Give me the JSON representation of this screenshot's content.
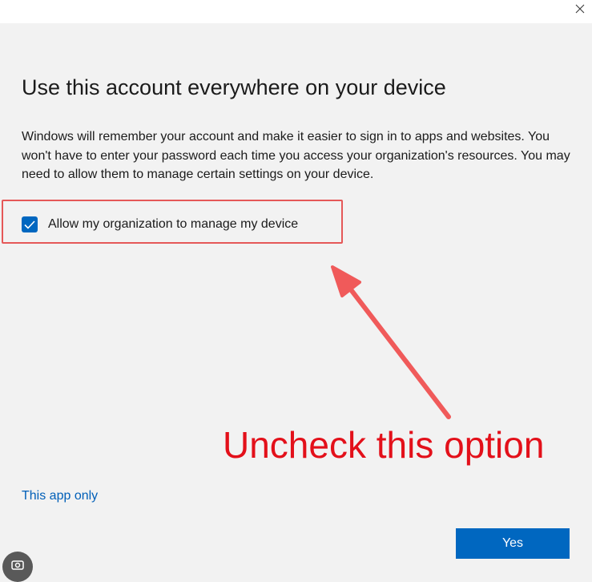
{
  "window": {
    "close_icon": "close-icon"
  },
  "dialog": {
    "heading": "Use this account everywhere on your device",
    "description": "Windows will remember your account and make it easier to sign in to apps and websites. You won't have to enter your password each time you access your organization's resources. You may need to allow them to manage certain settings on your device.",
    "checkbox": {
      "label": "Allow my organization to manage my device",
      "checked": true,
      "icon": "checkmark-icon"
    },
    "app_only_link": "This app only",
    "yes_button": "Yes"
  },
  "annotation": {
    "text": "Uncheck this option",
    "color": "#e3101a",
    "highlight_color": "#e55858"
  },
  "colors": {
    "accent": "#0067c0",
    "link": "#005fb8",
    "background": "#f2f2f2",
    "titlebar": "#ffffff"
  }
}
